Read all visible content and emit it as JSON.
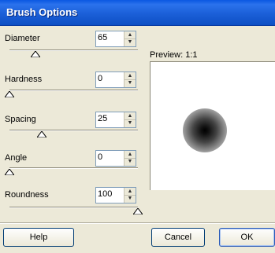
{
  "window": {
    "title": "Brush Options"
  },
  "controls": [
    {
      "label": "Diameter",
      "value": "65",
      "level": 0.2
    },
    {
      "label": "Hardness",
      "value": "0",
      "level": 0.0
    },
    {
      "label": "Spacing",
      "value": "25",
      "level": 0.25
    },
    {
      "label": "Angle",
      "value": "0",
      "level": 0.0
    },
    {
      "label": "Roundness",
      "value": "100",
      "level": 1.0
    }
  ],
  "preview": {
    "label": "Preview:  1:1"
  },
  "buttons": {
    "help": "Help",
    "cancel": "Cancel",
    "ok": "OK"
  },
  "icons": {
    "spin_up": "▲",
    "spin_down": "▼"
  }
}
